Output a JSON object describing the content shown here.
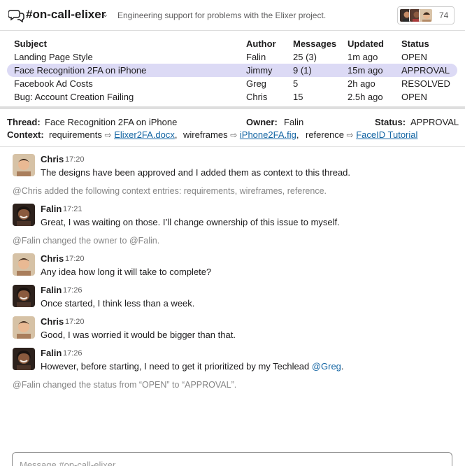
{
  "header": {
    "channel_name": "#on-call-elixer",
    "description": "Engineering support for problems with the Elixer project.",
    "member_count": "74",
    "icons": {
      "channel": "threads-icon",
      "chevron": "chevron-down-icon"
    }
  },
  "issues": {
    "columns": {
      "subject": "Subject",
      "author": "Author",
      "messages": "Messages",
      "updated": "Updated",
      "status": "Status"
    },
    "rows": [
      {
        "subject": "Landing Page Style",
        "author": "Falin",
        "messages": "25 (3)",
        "updated": "1m ago",
        "status": "OPEN"
      },
      {
        "subject": "Face Recognition 2FA on iPhone",
        "author": "Jimmy",
        "messages": "9 (1)",
        "updated": "15m ago",
        "status": "APPROVAL"
      },
      {
        "subject": "Facebook Ad Costs",
        "author": "Greg",
        "messages": "5",
        "updated": "2h ago",
        "status": "RESOLVED"
      },
      {
        "subject": "Bug: Account Creation Failing",
        "author": "Chris",
        "messages": "15",
        "updated": "2.5h ago",
        "status": "OPEN"
      }
    ],
    "selected_color": "#dcdaf5"
  },
  "thread": {
    "thread_label": "Thread:",
    "thread_value": "Face Recognition 2FA on iPhone",
    "owner_label": "Owner:",
    "owner_value": "Falin",
    "status_label": "Status:",
    "status_value": "APPROVAL",
    "context_label": "Context:",
    "context": [
      {
        "name": "requirements",
        "file": "Elixer2FA.docx",
        "sep": ","
      },
      {
        "name": "wireframes",
        "file": "iPhone2FA.fig",
        "sep": ","
      },
      {
        "name": "reference",
        "file": "FaceID Tutorial",
        "sep": ""
      }
    ]
  },
  "messages": [
    {
      "author": "Chris",
      "time": "17:20",
      "text": "The designs have been approved and I added them as context to this thread."
    },
    {
      "system": "@Chris added the following context entries: requirements, wireframes, reference."
    },
    {
      "author": "Falin",
      "time": "17:21",
      "text": "Great, I was waiting on those. I’ll change ownership of this issue to myself."
    },
    {
      "system": "@Falin changed the owner to @Falin."
    },
    {
      "author": "Chris",
      "time": "17:20",
      "text": "Any idea how long it will take to complete?"
    },
    {
      "author": "Falin",
      "time": "17:26",
      "text": "Once started, I think less than a week."
    },
    {
      "author": "Chris",
      "time": "17:20",
      "text": "Good, I was worried it would be bigger than that."
    },
    {
      "author": "Falin",
      "time": "17:26",
      "text": "However, before starting, I need to get it prioritized by my Techlead ",
      "mention": "@Greg",
      "after": "."
    },
    {
      "system": "@Falin changed the status from “OPEN” to “APPROVAL”."
    }
  ],
  "composer": {
    "placeholder": "Message #on-call-elixer"
  },
  "colors": {
    "link": "#1264a3",
    "muted": "#868686",
    "accent_selected": "#dcdaf5"
  }
}
